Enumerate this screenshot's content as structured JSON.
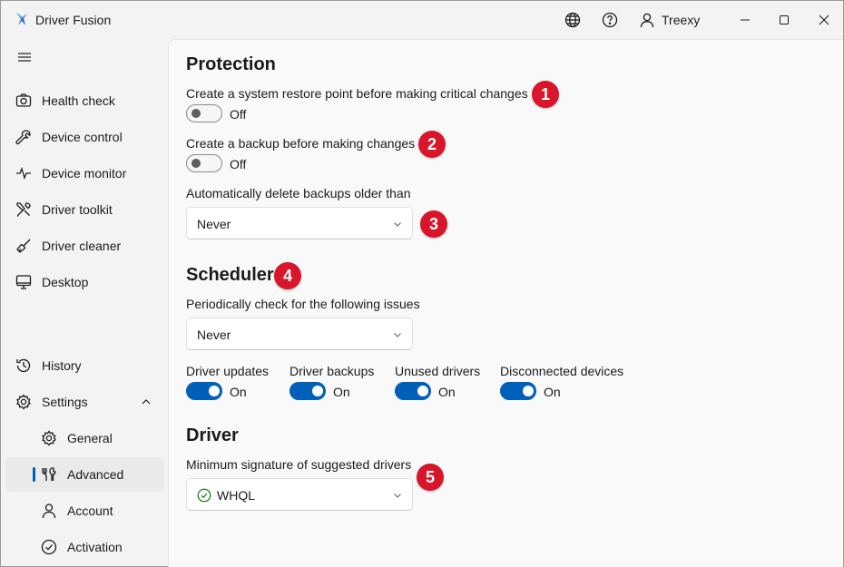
{
  "app": {
    "title": "Driver Fusion",
    "user": "Treexy"
  },
  "sidebar": {
    "items": [
      {
        "label": "Health check",
        "icon": "camera-icon"
      },
      {
        "label": "Device control",
        "icon": "wrench-icon"
      },
      {
        "label": "Device monitor",
        "icon": "pulse-icon"
      },
      {
        "label": "Driver toolkit",
        "icon": "tools-icon"
      },
      {
        "label": "Driver cleaner",
        "icon": "broom-icon"
      },
      {
        "label": "Desktop",
        "icon": "monitor-icon"
      }
    ],
    "bottom_items": [
      {
        "label": "History",
        "icon": "history-icon"
      },
      {
        "label": "Settings",
        "icon": "gear-icon",
        "expanded": true
      }
    ],
    "settings_sub": [
      {
        "label": "General",
        "icon": "gear-icon"
      },
      {
        "label": "Advanced",
        "icon": "tools-icon",
        "selected": true
      },
      {
        "label": "Account",
        "icon": "person-icon"
      },
      {
        "label": "Activation",
        "icon": "check-circle-icon"
      }
    ]
  },
  "protection": {
    "title": "Protection",
    "restore_point": {
      "label": "Create a system restore point before making critical changes",
      "state": "Off"
    },
    "backup": {
      "label": "Create a backup before making changes",
      "state": "Off"
    },
    "auto_delete": {
      "label": "Automatically delete backups older than",
      "value": "Never"
    }
  },
  "scheduler": {
    "title": "Scheduler",
    "label": "Periodically check for the following issues",
    "value": "Never",
    "toggles": [
      {
        "label": "Driver updates",
        "state": "On"
      },
      {
        "label": "Driver backups",
        "state": "On"
      },
      {
        "label": "Unused drivers",
        "state": "On"
      },
      {
        "label": "Disconnected devices",
        "state": "On"
      }
    ]
  },
  "driver": {
    "title": "Driver",
    "label": "Minimum signature of suggested drivers",
    "value": "WHQL"
  },
  "badges": [
    "1",
    "2",
    "3",
    "4",
    "5"
  ],
  "colors": {
    "accent": "#005fb8",
    "badge": "#d8152a",
    "check": "#0f7b0f"
  }
}
